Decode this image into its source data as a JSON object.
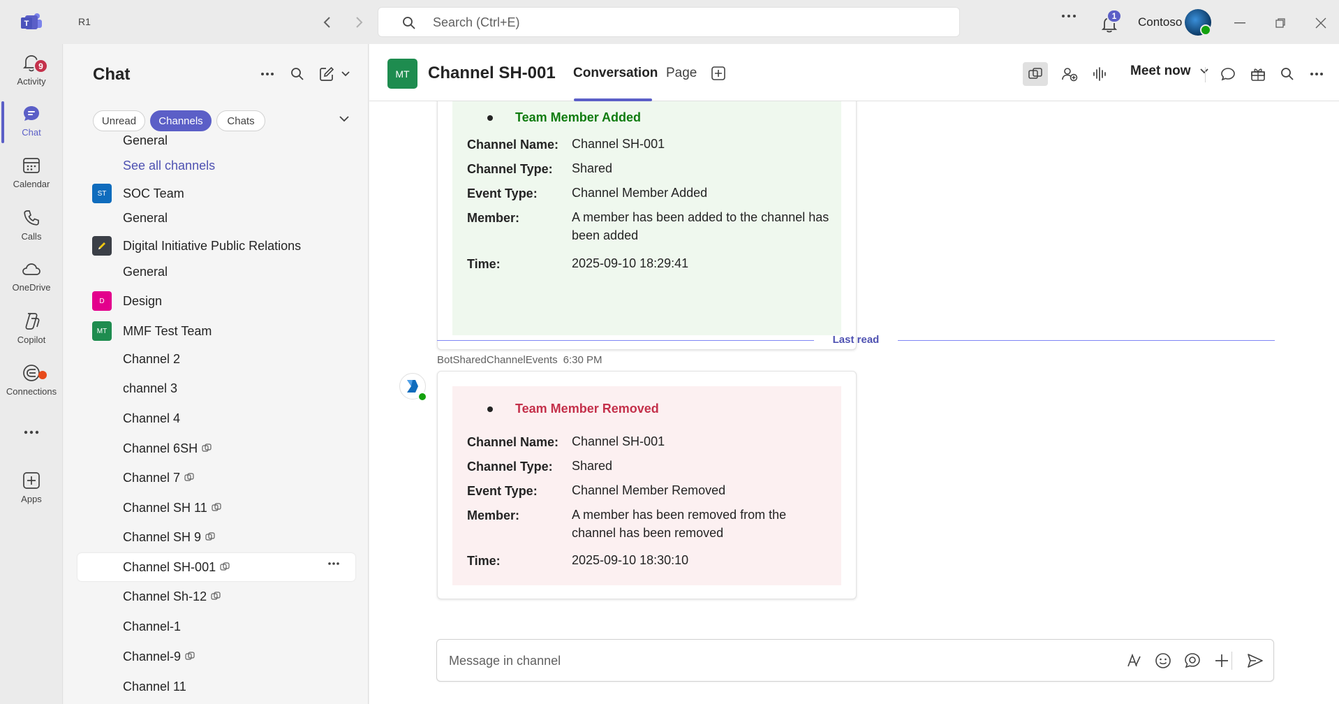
{
  "titlebar": {
    "label": "R1",
    "search_placeholder": "Search (Ctrl+E)",
    "notification_count": "1",
    "org_name": "Contoso"
  },
  "rail": {
    "items": [
      {
        "label": "Activity",
        "icon": "bell-icon"
      },
      {
        "label": "Chat",
        "icon": "chat-icon",
        "badge": "9"
      },
      {
        "label": "Calendar",
        "icon": "calendar-icon"
      },
      {
        "label": "Calls",
        "icon": "phone-icon"
      },
      {
        "label": "OneDrive",
        "icon": "cloud-icon"
      },
      {
        "label": "Copilot",
        "icon": "copilot-icon"
      },
      {
        "label": "Connections",
        "icon": "connections-icon"
      },
      {
        "label": "Apps",
        "icon": "add-apps-icon"
      }
    ]
  },
  "sidebar": {
    "title": "Chat",
    "filters": [
      "Unread",
      "Channels",
      "Chats"
    ],
    "active_filter": "Channels",
    "rows": [
      {
        "text": "General",
        "kind": "channel"
      },
      {
        "text": "See all channels",
        "kind": "link"
      },
      {
        "text": "SOC Team",
        "kind": "team",
        "tile": "ST",
        "color": "#0f6cbd"
      },
      {
        "text": "General",
        "kind": "channel"
      },
      {
        "text": "Digital Initiative Public Relations",
        "kind": "team",
        "tile": "",
        "color": "#3b3f47"
      },
      {
        "text": "General",
        "kind": "channel"
      },
      {
        "text": "Design",
        "kind": "team",
        "tile": "D",
        "color": "#e3008c"
      },
      {
        "text": "MMF Test Team",
        "kind": "team",
        "tile": "MT",
        "color": "#1e8c4f"
      },
      {
        "text": "Channel 2",
        "kind": "channel"
      },
      {
        "text": "channel 3",
        "kind": "channel"
      },
      {
        "text": "Channel 4",
        "kind": "channel"
      },
      {
        "text": "Channel 6SH",
        "kind": "channel",
        "shared": true
      },
      {
        "text": "Channel 7",
        "kind": "channel",
        "shared": true
      },
      {
        "text": "Channel SH 11",
        "kind": "channel",
        "shared": true
      },
      {
        "text": "Channel SH 9",
        "kind": "channel",
        "shared": true
      },
      {
        "text": "Channel SH-001",
        "kind": "channel",
        "shared": true,
        "selected": true
      },
      {
        "text": "Channel Sh-12",
        "kind": "channel",
        "shared": true
      },
      {
        "text": "Channel-1",
        "kind": "channel"
      },
      {
        "text": "Channel-9",
        "kind": "channel",
        "shared": true
      },
      {
        "text": "Channel 11",
        "kind": "channel"
      }
    ]
  },
  "channel": {
    "tile": "MT",
    "title": "Channel SH-001",
    "tabs": [
      "Conversation",
      "Page"
    ],
    "active_tab": "Conversation",
    "meet_now_label": "Meet now"
  },
  "messages": {
    "card1": {
      "heading": "Team Member Added",
      "rows": [
        {
          "key": "Channel Name:",
          "value": "Channel SH-001"
        },
        {
          "key": "Channel Type:",
          "value": "Shared"
        },
        {
          "key": "Event Type:",
          "value": "Channel Member Added"
        },
        {
          "key": "Member:",
          "value": "A member has been added to the channel has been added"
        },
        {
          "key": "Time:",
          "value": "2025-09-10 18:29:41"
        }
      ]
    },
    "last_read": "Last read",
    "card2_sender": "BotSharedChannelEvents",
    "card2_time": "6:30 PM",
    "card2": {
      "heading": "Team Member Removed",
      "rows": [
        {
          "key": "Channel Name:",
          "value": "Channel SH-001"
        },
        {
          "key": "Channel Type:",
          "value": "Shared"
        },
        {
          "key": "Event Type:",
          "value": "Channel Member Removed"
        },
        {
          "key": "Member:",
          "value": "A member has been removed from the channel has been removed"
        },
        {
          "key": "Time:",
          "value": "2025-09-10 18:30:10"
        }
      ]
    }
  },
  "composer": {
    "placeholder": "Message in channel"
  },
  "colors": {
    "brand": "#5b5fc7",
    "added_green": "#107c10",
    "removed_red": "#c4314b"
  }
}
